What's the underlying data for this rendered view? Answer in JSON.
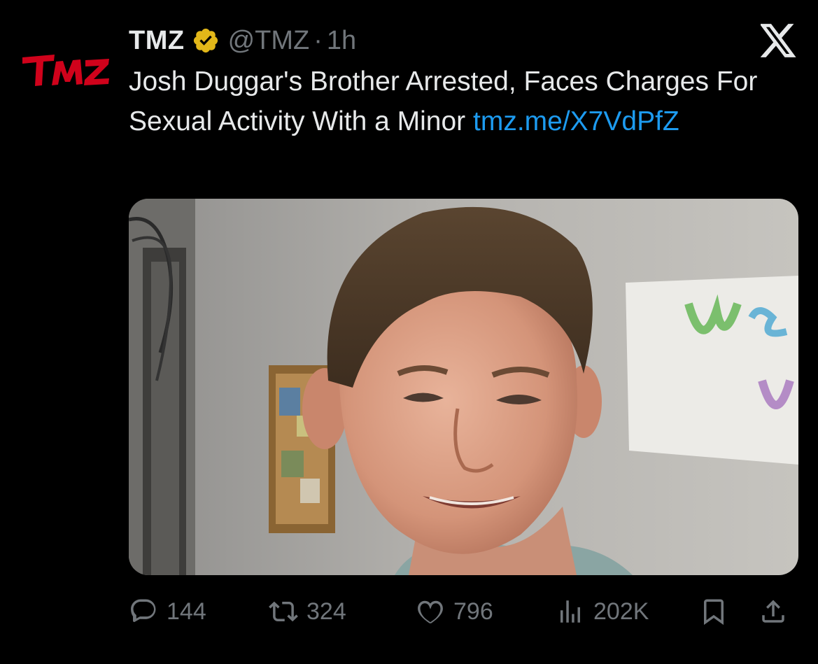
{
  "tweet": {
    "display_name": "TMZ",
    "handle": "@TMZ",
    "separator": "·",
    "time": "1h",
    "text_main": "Josh Duggar's Brother Arrested, Faces Charges For Sexual Activity With a Minor ",
    "link_text": "tmz.me/X7VdPfZ",
    "avatar_logo_text": "TMZ",
    "verified_icon": "verified-badge-icon",
    "platform_icon": "x-logo-icon",
    "media_alt": "photo of a smiling young man with brown hair"
  },
  "actions": {
    "replies": "144",
    "retweets": "324",
    "likes": "796",
    "views": "202K"
  },
  "colors": {
    "background": "#000000",
    "text_primary": "#e7e9ea",
    "text_secondary": "#71767b",
    "link": "#1d9bf0",
    "brand_red": "#d0021b",
    "verified_gold": "#e2b719"
  }
}
